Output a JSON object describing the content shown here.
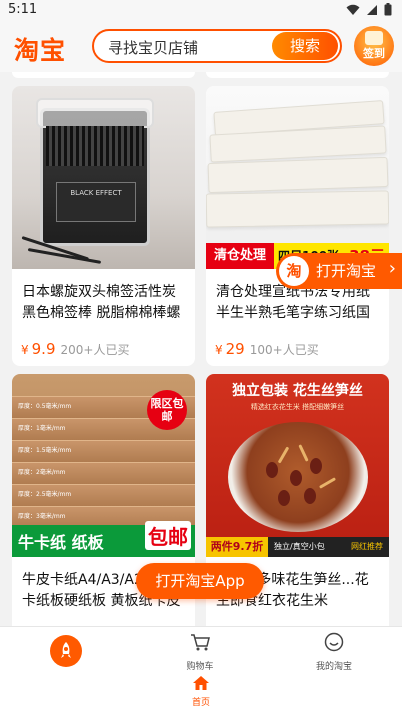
{
  "status_bar": {
    "time": "5:11"
  },
  "header": {
    "logo_text": "淘宝",
    "search_placeholder": "寻找宝贝店铺",
    "search_button": "搜索",
    "signin_label": "签到"
  },
  "products": [
    {
      "title": "日本螺旋双头棉签活性炭黑色棉签棒 脱脂棉棉棒螺",
      "currency": "¥",
      "price": "9.9",
      "sold": "200+人已买",
      "image_label": "BLACK EFFECT"
    },
    {
      "title": "清仓处理宣纸书法专用纸半生半熟毛笔字练习纸国",
      "currency": "¥",
      "price": "29",
      "sold": "100+人已买",
      "banner": {
        "left": "清仓处理",
        "middle": "四尺100张",
        "right": "38元"
      }
    },
    {
      "title": "牛皮卡纸A4/A3/A2牛皮纸卡纸板硬纸板 黄板纸卡皮",
      "image_tag": "限区包邮",
      "band_left": "牛卡纸 纸板",
      "band_right": "包邮",
      "sheet_labels": [
        "厚度：0.5毫米/mm",
        "厚度：1毫米/mm",
        "厚度：1.5毫米/mm",
        "厚度：2毫米/mm",
        "厚度：2.5毫米/mm",
        "厚度：3毫米/mm"
      ]
    },
    {
      "title": "...阳余多味花生笋丝...花生即食红衣花生米",
      "image_head": "独立包装 花生丝笋丝",
      "image_sub": "精选红衣花生米 搭配细嫩笋丝",
      "band": {
        "left": "两件9.7折",
        "middle": "独立/真空小包",
        "right": "网红推荐"
      }
    }
  ],
  "open_taobao_side": {
    "icon_text": "淘",
    "label": "打开淘宝",
    "chevron": "›"
  },
  "open_app_button": "打开淘宝App",
  "bottom_nav": {
    "cart_label": "购物车",
    "mine_label": "我的淘宝",
    "home_label": "首页"
  },
  "colors": {
    "accent": "#ff5000",
    "accent_gradient_start": "#ff8a00",
    "background": "#f2f2f2"
  }
}
